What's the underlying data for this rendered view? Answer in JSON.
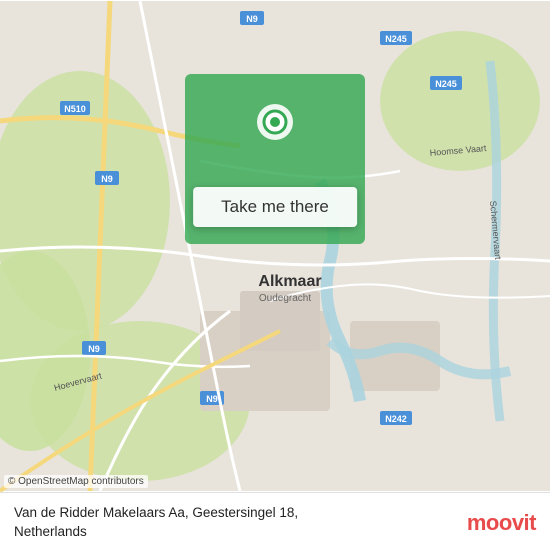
{
  "map": {
    "city": "Alkmaar",
    "country": "Netherlands",
    "attribution": "© OpenStreetMap contributors"
  },
  "button": {
    "label": "Take me there"
  },
  "footer": {
    "address_line1": "Van de Ridder Makelaars Aa, Geestersingel 18,",
    "address_line2": "Netherlands"
  },
  "logo": {
    "text": "moovit"
  },
  "colors": {
    "green_overlay": "#34A853",
    "road_yellow": "#f5d87c",
    "road_white": "#ffffff",
    "water_blue": "#aad3df",
    "land_light": "#e8e0d8",
    "land_green": "#c8dfa8",
    "moovit_red": "#e84b4b"
  }
}
